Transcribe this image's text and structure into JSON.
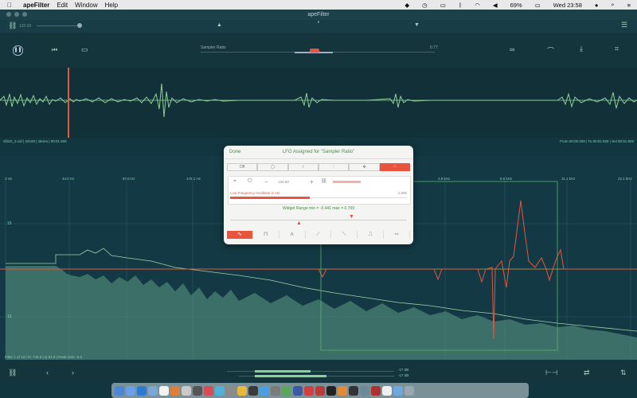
{
  "menubar": {
    "app": "apeFilter",
    "items": [
      "Edit",
      "Window",
      "Help"
    ],
    "battery": "69%",
    "clock": "Wed 23:58"
  },
  "window": {
    "title": "apeFilter"
  },
  "toolbar1": {
    "left_value": "120.00",
    "center_line1": "ℹ️",
    "center_line2": "ℹ️"
  },
  "toolbar2": {
    "slider_label": "Sampler Ratio",
    "slider_value": "0.77"
  },
  "wave_info": {
    "left": "Glitch_3.caf | 44100 | stereo | 00:01.826",
    "right": "From 00:00.000 | To 00:01.826 | Sel 00:01.826"
  },
  "freq_ticks": [
    "3 Hz",
    "44.0 Hz",
    "87.8 Hz",
    "175.1 Hz",
    "2.8 kHz",
    "5.6 kHz",
    "11.1 kHz",
    "22.1 kHz"
  ],
  "db_ticks": [
    "15",
    "15"
  ],
  "filter_info": "Filter 1 of 13 | Fc 740.9 | Q 81.9 | Peak Gain -6.0",
  "modal": {
    "done": "Done",
    "title": "LFO Assigned for \"Sampler Ratio\"",
    "segments": [
      "Off",
      "",
      "",
      "",
      "",
      ""
    ],
    "lfo_label": "Low Frequency Oscillator in Hz",
    "lfo_value": "1.000",
    "lfo_rate": "120.00",
    "range_text": "Widget Range min = -0.441 max = 0.709",
    "shapes": [
      "sine",
      "square",
      "triangle",
      "saw-up",
      "saw-down",
      "random-step",
      "random-smooth"
    ]
  },
  "bottombar": {
    "center_readout1": "-17 dB",
    "center_readout2": "-17 dB"
  },
  "colors": {
    "accent": "#e8543e",
    "green": "#8fcf97",
    "bg": "#12363f"
  }
}
